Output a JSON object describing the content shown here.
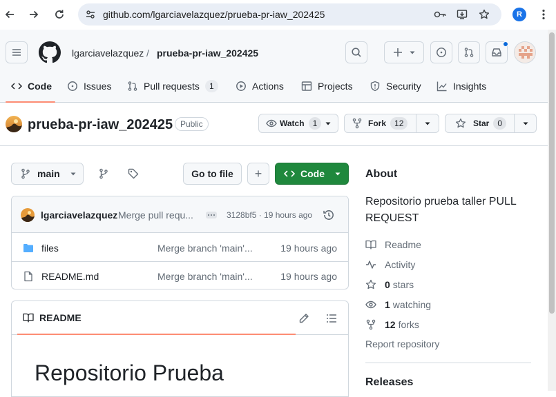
{
  "browser": {
    "url": "github.com/lgarciavelazquez/prueba-pr-iaw_202425",
    "profile_initial": "R"
  },
  "header": {
    "owner": "lgarciavelazquez",
    "separator": "/",
    "repo": "prueba-pr-iaw_202425"
  },
  "tabs": [
    {
      "label": "Code",
      "icon": "code-icon",
      "selected": true
    },
    {
      "label": "Issues",
      "icon": "issue-opened-icon"
    },
    {
      "label": "Pull requests",
      "icon": "git-pull-request-icon",
      "count": "1"
    },
    {
      "label": "Actions",
      "icon": "play-icon"
    },
    {
      "label": "Projects",
      "icon": "table-icon"
    },
    {
      "label": "Security",
      "icon": "shield-icon"
    },
    {
      "label": "Insights",
      "icon": "graph-icon"
    }
  ],
  "repo": {
    "name": "prueba-pr-iaw_202425",
    "visibility": "Public",
    "watch_label": "Watch",
    "watch_count": "1",
    "fork_label": "Fork",
    "fork_count": "12",
    "star_label": "Star",
    "star_count": "0"
  },
  "toolbar": {
    "branch": "main",
    "goto_file": "Go to file",
    "add": "+",
    "code": "Code"
  },
  "commit": {
    "author": "lgarciavelazquez",
    "message": "Merge pull requ...",
    "meta": "3128bf5 · 19 hours ago"
  },
  "files": [
    {
      "name": "files",
      "type": "folder",
      "message": "Merge branch 'main'...",
      "date": "19 hours ago"
    },
    {
      "name": "README.md",
      "type": "file",
      "message": "Merge branch 'main'...",
      "date": "19 hours ago"
    }
  ],
  "readme": {
    "tab_label": "README",
    "heading": "Repositorio Prueba"
  },
  "about": {
    "title": "About",
    "description": "Repositorio prueba taller PULL REQUEST",
    "readme": "Readme",
    "activity": "Activity",
    "stars_count": "0",
    "stars_label": "stars",
    "watching_count": "1",
    "watching_label": "watching",
    "forks_count": "12",
    "forks_label": "forks",
    "report": "Report repository",
    "releases": "Releases"
  },
  "colors": {
    "accent_underline": "#fd8c73",
    "code_button": "#1f883d",
    "folder": "#54aeff",
    "notification_dot": "#0969da"
  }
}
